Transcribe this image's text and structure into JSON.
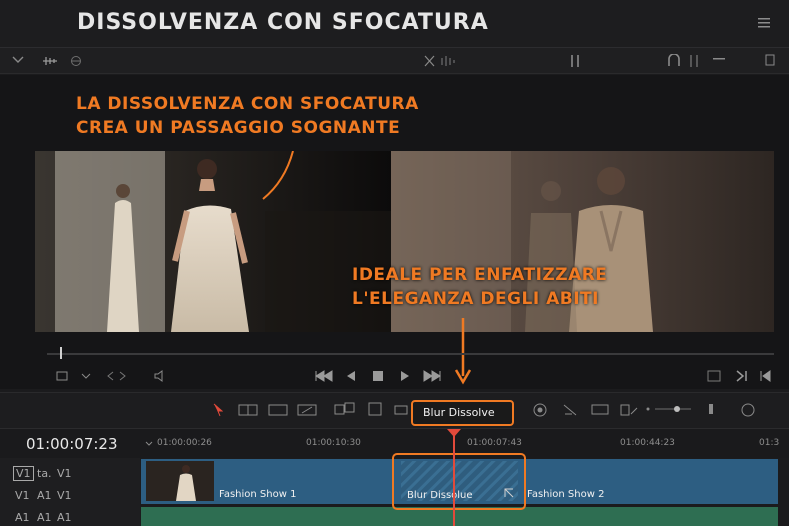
{
  "app": {
    "title": "DISSOLVENZA CON SFOCATURA"
  },
  "annotations": {
    "top_line1": "LA DISSOLVENZA CON SFOCATURA",
    "top_line2": "CREA UN PASSAGGIO SOGNANTE",
    "bottom_line1": "IDEALE PER ENFATIZZARE",
    "bottom_line2": "L'ELEGANZA DEGLI ABITI"
  },
  "timeline": {
    "timecode": "01:00:07:23",
    "ruler": [
      "01:00:00:26",
      "01:00:10:30",
      "01:00:07:43",
      "01:00:44:23",
      "01:3"
    ],
    "transition_name": "Blur Dissolve",
    "transition_clip_label": "Blur Dissolue",
    "clips": {
      "clip1": "Fashion Show 1",
      "clip2": "Fashion Show 2"
    },
    "tracks": {
      "row1": [
        "V1",
        "ta.",
        "V1"
      ],
      "row2": [
        "V1",
        "A1",
        "V1"
      ],
      "row3": [
        "A1",
        "A1",
        "A1"
      ]
    }
  },
  "colors": {
    "accent": "#f07a23",
    "clip_blue": "#2d5e82",
    "clip_green": "#2e6e52",
    "playhead": "#e24a3b"
  },
  "icons": [
    "menu-icon",
    "collapse-chevron-icon",
    "audio-level-icon",
    "link-icon",
    "cut-icon",
    "skip-back-icon",
    "step-back-icon",
    "stop-icon",
    "play-icon",
    "skip-forward-icon",
    "select-arrow-icon",
    "snap-icon",
    "zoom-slider-icon"
  ]
}
